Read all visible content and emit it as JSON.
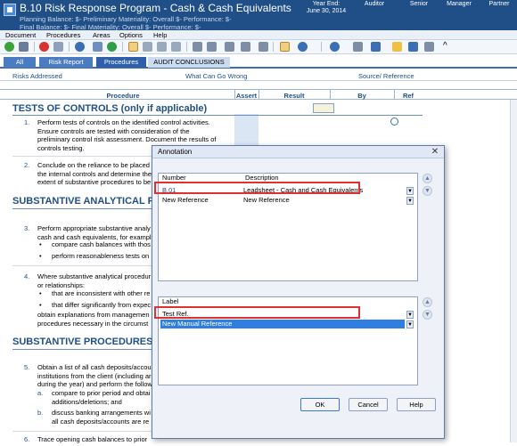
{
  "window": {
    "title": "B.10 Risk Response Program - Cash & Cash Equivalents",
    "balances_line1": "Planning Balance: $-      Preliminary Materiality: Overall $-      Performance: $-",
    "balances_line2": "Final Balance: $-      Final Materiality: Overall $-      Performance: $-",
    "year_end_label": "Year End:",
    "year_end_value": "June 30, 2014",
    "roles": [
      "Auditor",
      "Senior",
      "Manager",
      "Partner"
    ]
  },
  "menu": [
    "Document",
    "Procedures",
    "Areas",
    "Options",
    "Help"
  ],
  "tabs": [
    "All",
    "Risk Report",
    "Procedures",
    "AUDIT CONCLUSIONS"
  ],
  "risks_row": {
    "risks_addressed": "Risks Addressed",
    "what_can_go_wrong": "What Can Go Wrong",
    "source_reference": "Source/ Reference"
  },
  "columns": [
    "Procedure",
    "Assert",
    "Result",
    "By",
    "Ref"
  ],
  "sections": {
    "tests_of_controls": "TESTS OF CONTROLS (only if applicable)",
    "substantive_analytical": "SUBSTANTIVE ANALYTICAL PROC",
    "substantive_procedures": "SUBSTANTIVE PROCEDURES (or"
  },
  "procedures": {
    "p1_num": "1.",
    "p1_lines": [
      "Perform tests of controls on the identified control activities.",
      "Ensure controls are tested with consideration of the",
      "preliminary control risk assessment. Document the results of",
      "controls testing."
    ],
    "p2_num": "2.",
    "p2_lines": [
      "Conclude on the reliance to be placed",
      "the internal controls and determine the",
      "extent of substantive procedures to be"
    ],
    "p3_num": "3.",
    "p3_lines": [
      "Perform appropriate substantive analy",
      "cash and cash equivalents, for exampl"
    ],
    "p3_bullets": [
      "compare cash balances with thos",
      "perform reasonableness tests on"
    ],
    "p4_num": "4.",
    "p4_lines": [
      "Where substantive analytical procedur",
      "or relationships:"
    ],
    "p4_bullets": [
      "that are inconsistent with other re",
      "that differ significantly from expec"
    ],
    "p4_tail": [
      "obtain explanations from managemen",
      "procedures necessary in the circumst"
    ],
    "p5_num": "5.",
    "p5_lines": [
      "Obtain a list of all cash deposits/accou",
      "institutions from the client (including ar",
      "during the year) and perform the follow"
    ],
    "p5_a_letter": "a.",
    "p5_a_lines": [
      "compare to prior period and obtai",
      "additions/deletions; and"
    ],
    "p5_b_letter": "b.",
    "p5_b_lines": [
      "discuss banking arrangements wi",
      "all cash deposits/accounts are re"
    ],
    "p6_num": "6.",
    "p6_line": "Trace opening cash balances to prior"
  },
  "dialog": {
    "title": "Annotation",
    "close_glyph": "✕",
    "top_grid": {
      "headers": [
        "Number",
        "Description"
      ],
      "rows": [
        {
          "number": "B.01",
          "description": "Leadsheet - Cash and Cash Equivalents"
        },
        {
          "number": "New Reference",
          "description": "New Reference"
        }
      ]
    },
    "label_grid": {
      "header": "Label",
      "rows": [
        "Test Ref.",
        "New Manual Reference"
      ]
    },
    "buttons": {
      "ok": "OK",
      "cancel": "Cancel",
      "help": "Help"
    },
    "arrow_down": "▼",
    "arrow_up": "▲"
  },
  "colors": {
    "titlebar": "#1f4f86",
    "accent": "#3b6fb2",
    "highlight": "#2f7fe0",
    "red_annotation": "#e03030"
  }
}
